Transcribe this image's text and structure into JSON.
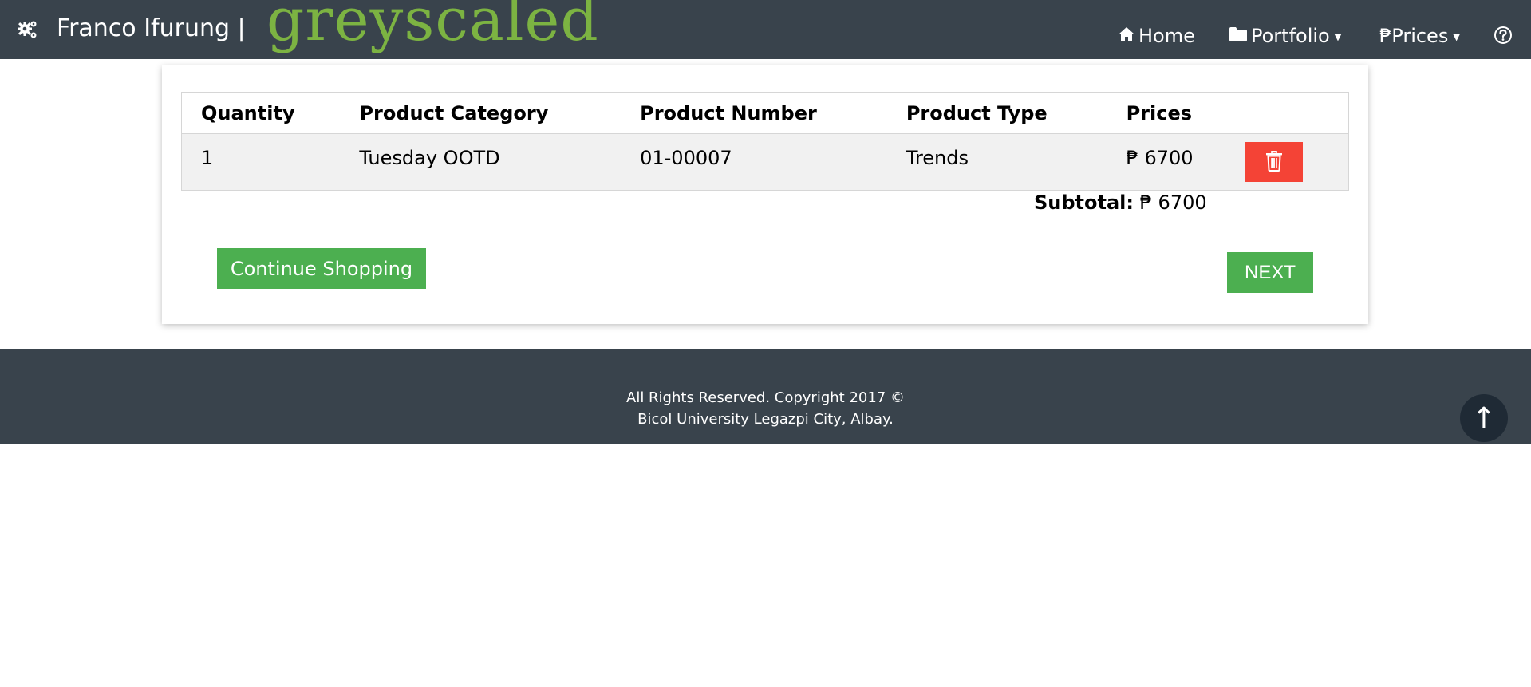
{
  "brand": {
    "name": "Franco Ifurung |",
    "logo_text": "greyscaled",
    "gear_icon": "gears-icon"
  },
  "nav": {
    "home": {
      "label": "Home",
      "icon": "home-icon"
    },
    "portfolio": {
      "label": "Portfolio",
      "icon": "folder-icon"
    },
    "prices": {
      "label": "₱Prices"
    },
    "help": {
      "icon": "help-icon"
    }
  },
  "cart": {
    "headers": [
      "Quantity",
      "Product Category",
      "Product Number",
      "Product Type",
      "Prices"
    ],
    "rows": [
      {
        "quantity": "1",
        "category": "Tuesday OOTD",
        "number": "01-00007",
        "type": "Trends",
        "price": "₱ 6700",
        "delete_icon": "trash-icon"
      }
    ],
    "subtotal_label": "Subtotal:",
    "subtotal_value": "₱ 6700"
  },
  "buttons": {
    "continue": "Continue Shopping",
    "next": "NEXT"
  },
  "footer": {
    "line1": "All Rights Reserved. Copyright 2017 ©",
    "line2": "Bicol University Legazpi City, Albay.",
    "top_button": "↑"
  },
  "colors": {
    "navbar_bg": "#39434c",
    "logo_green": "#7cb342",
    "button_green": "#4caf50",
    "delete_red": "#f44336"
  }
}
